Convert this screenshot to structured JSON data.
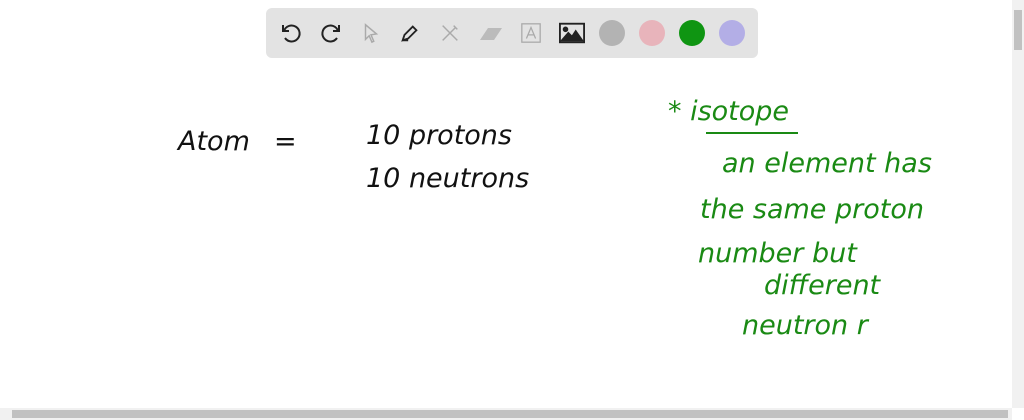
{
  "toolbar": {
    "tools": [
      "undo-icon",
      "redo-icon",
      "select-icon",
      "pen-icon",
      "tools-icon",
      "eraser-icon",
      "text-icon",
      "image-icon"
    ],
    "colors": [
      "#b3b3b3",
      "#e8b4bb",
      "#0f9512",
      "#b3aee6"
    ]
  },
  "board": {
    "black": {
      "atom": "Atom",
      "equals": "=",
      "line1": "10 protons",
      "line2": "10 neutrons"
    },
    "green": {
      "heading": "* isotope",
      "lines": [
        "an element has",
        "the same proton",
        "number but",
        "different",
        "neutron r"
      ]
    }
  }
}
